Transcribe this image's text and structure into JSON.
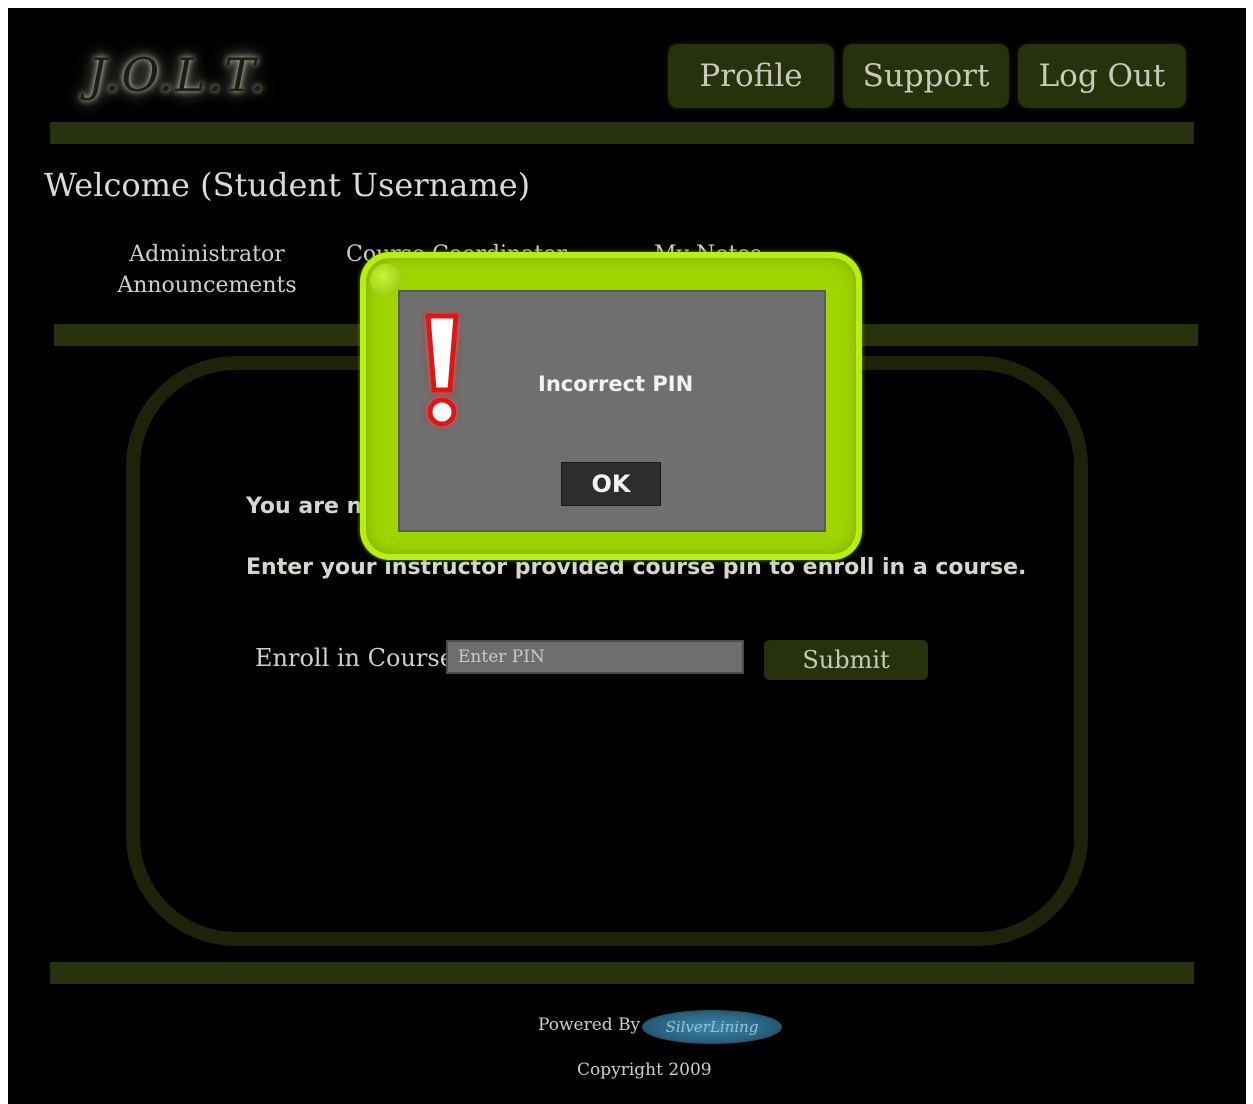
{
  "header": {
    "logo": "J.O.L.T.",
    "nav": {
      "profile": "Profile",
      "support": "Support",
      "logout": "Log Out"
    }
  },
  "welcome": "Welcome (Student Username)",
  "tabs": {
    "admin_line1": "Administrator",
    "admin_line2": "Announcements",
    "course_coordinator": "Course Coordinator",
    "third": "My Notes"
  },
  "main": {
    "not_enrolled": "You are not currently enrolled in any courses.",
    "instruction": "Enter your instructor provided course pin to enroll in a course.",
    "enroll_label": "Enroll in Course",
    "pin_placeholder": "Enter PIN",
    "submit_label": "Submit"
  },
  "footer": {
    "powered_by": "Powered By",
    "sponsor": "SilverLining",
    "copyright": "Copyright 2009"
  },
  "modal": {
    "message": "Incorrect PIN",
    "ok_label": "OK",
    "alert_icon": "exclamation-icon"
  },
  "colors": {
    "background": "#000000",
    "accent": "#27310b",
    "modal_frame": "#9ed400",
    "alert": "#e01818"
  }
}
